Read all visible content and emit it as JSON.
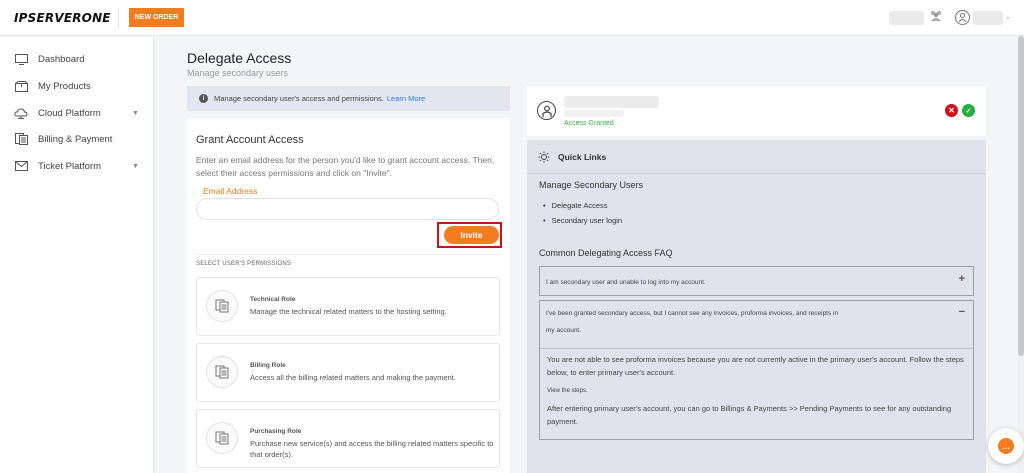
{
  "brand": {
    "logo_text": "IPSERVERONE",
    "new_order_label": "NEW ORDER",
    "accent": "#f47c20"
  },
  "header_icons": {
    "team_icon": "users-icon",
    "account_icon": "user-circle-icon"
  },
  "sidebar": {
    "items": [
      {
        "label": "Dashboard",
        "icon": "monitor-icon",
        "chevron": false
      },
      {
        "label": "My Products",
        "icon": "box-icon",
        "chevron": false
      },
      {
        "label": "Cloud Platform",
        "icon": "cloud-icon",
        "chevron": true
      },
      {
        "label": "Billing & Payment",
        "icon": "invoice-icon",
        "chevron": true
      },
      {
        "label": "Ticket Platform",
        "icon": "mail-icon",
        "chevron": true
      }
    ]
  },
  "page": {
    "title": "Delegate Access",
    "subtitle": "Manage secondary users"
  },
  "info_banner": {
    "text": "Manage secondary user's access and permissions.",
    "link": "Learn More"
  },
  "grant": {
    "title": "Grant Account Access",
    "description": "Enter an email address for the person you'd like to grant account access. Then, select their access permissions and click on \"Invite\".",
    "email_label": "Email Address",
    "email_value": "",
    "invite_label": "Invite",
    "permissions_heading": "SELECT USER'S PERMISSIONS",
    "roles": [
      {
        "title": "Technical Role",
        "description": "Manage the technical related matters to the hosting setting."
      },
      {
        "title": "Billing Role",
        "description": "Access all the billing related matters and making the payment."
      },
      {
        "title": "Purchasing Role",
        "description": "Purchase new service(s) and access the billing related matters specific to that order(s)."
      }
    ]
  },
  "granted_user": {
    "status": "Access Granted",
    "status_color": "#3cb043"
  },
  "quick_links": {
    "title": "Quick Links",
    "manage_heading": "Manage Secondary Users",
    "links": [
      "Delegate Access",
      "Secondary user login"
    ],
    "faq_heading": "Common Delegating Access FAQ",
    "faqs": [
      {
        "question": "I am secondary user and unable to log into my account.",
        "toggle": "+"
      },
      {
        "question_line1": "I've been granted secondary access, but I cannot see any invoices, proforma invoices, and receipts in",
        "question_line2": "my account.",
        "toggle": "−",
        "answer_p1": "You are not able to see proforma invoices because you are not currently active in the primary user's account. Follow the steps below, to enter primary user's account.",
        "answer_small": "View the steps.",
        "answer_p2": "After entering primary user's account, you can go to Billings & Payments >> Pending Payments to see for any outstanding payment."
      }
    ]
  }
}
